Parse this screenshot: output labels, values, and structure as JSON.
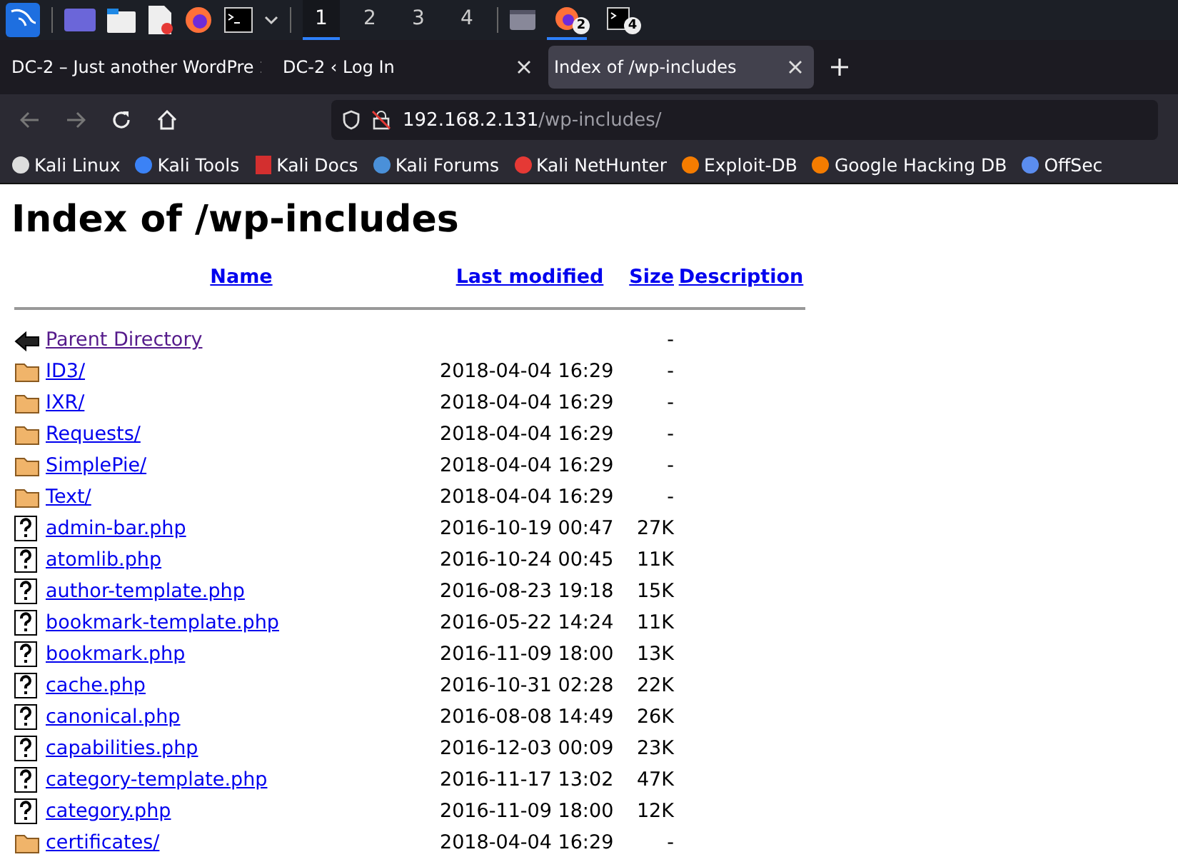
{
  "taskbar": {
    "workspaces": [
      {
        "label": "1",
        "selected": true
      },
      {
        "label": "2",
        "selected": false
      },
      {
        "label": "3",
        "selected": false
      },
      {
        "label": "4",
        "selected": false
      }
    ],
    "windows": [
      {
        "kind": "firefox",
        "count": "2",
        "selected": true
      },
      {
        "kind": "terminal",
        "count": "4",
        "selected": false
      }
    ]
  },
  "tabs": [
    {
      "title": "DC-2 – Just another WordPre",
      "selected": false
    },
    {
      "title": "DC-2 ‹ Log In",
      "selected": false
    },
    {
      "title": "Index of /wp-includes",
      "selected": true
    }
  ],
  "address": {
    "host": "192.168.2.131",
    "path": "/wp-includes/"
  },
  "bookmarks": [
    {
      "kind": "dragon",
      "label": "Kali Linux"
    },
    {
      "kind": "tools",
      "label": "Kali Tools"
    },
    {
      "kind": "docs",
      "label": "Kali Docs"
    },
    {
      "kind": "forums",
      "label": "Kali Forums"
    },
    {
      "kind": "nethunter",
      "label": "Kali NetHunter"
    },
    {
      "kind": "exploit",
      "label": "Exploit-DB"
    },
    {
      "kind": "exploit",
      "label": "Google Hacking DB"
    },
    {
      "kind": "offsec",
      "label": "OffSec"
    }
  ],
  "page": {
    "heading": "Index of /wp-includes",
    "columns": [
      "Name",
      "Last modified",
      "Size",
      "Description"
    ],
    "rows": [
      {
        "kind": "parent",
        "name": "Parent Directory",
        "modified": "",
        "size": "-",
        "visited": true
      },
      {
        "kind": "folder",
        "name": "ID3/",
        "modified": "2018-04-04 16:29",
        "size": "-",
        "visited": false
      },
      {
        "kind": "folder",
        "name": "IXR/",
        "modified": "2018-04-04 16:29",
        "size": "-",
        "visited": false
      },
      {
        "kind": "folder",
        "name": "Requests/",
        "modified": "2018-04-04 16:29",
        "size": "-",
        "visited": false
      },
      {
        "kind": "folder",
        "name": "SimplePie/",
        "modified": "2018-04-04 16:29",
        "size": "-",
        "visited": false
      },
      {
        "kind": "folder",
        "name": "Text/",
        "modified": "2018-04-04 16:29",
        "size": "-",
        "visited": false
      },
      {
        "kind": "file",
        "name": "admin-bar.php",
        "modified": "2016-10-19 00:47",
        "size": "27K",
        "visited": false
      },
      {
        "kind": "file",
        "name": "atomlib.php",
        "modified": "2016-10-24 00:45",
        "size": "11K",
        "visited": false
      },
      {
        "kind": "file",
        "name": "author-template.php",
        "modified": "2016-08-23 19:18",
        "size": "15K",
        "visited": false
      },
      {
        "kind": "file",
        "name": "bookmark-template.php",
        "modified": "2016-05-22 14:24",
        "size": "11K",
        "visited": false
      },
      {
        "kind": "file",
        "name": "bookmark.php",
        "modified": "2016-11-09 18:00",
        "size": "13K",
        "visited": false
      },
      {
        "kind": "file",
        "name": "cache.php",
        "modified": "2016-10-31 02:28",
        "size": "22K",
        "visited": false
      },
      {
        "kind": "file",
        "name": "canonical.php",
        "modified": "2016-08-08 14:49",
        "size": "26K",
        "visited": false
      },
      {
        "kind": "file",
        "name": "capabilities.php",
        "modified": "2016-12-03 00:09",
        "size": "23K",
        "visited": false
      },
      {
        "kind": "file",
        "name": "category-template.php",
        "modified": "2016-11-17 13:02",
        "size": "47K",
        "visited": false
      },
      {
        "kind": "file",
        "name": "category.php",
        "modified": "2016-11-09 18:00",
        "size": "12K",
        "visited": false
      },
      {
        "kind": "folder",
        "name": "certificates/",
        "modified": "2018-04-04 16:29",
        "size": "-",
        "visited": false
      }
    ]
  }
}
